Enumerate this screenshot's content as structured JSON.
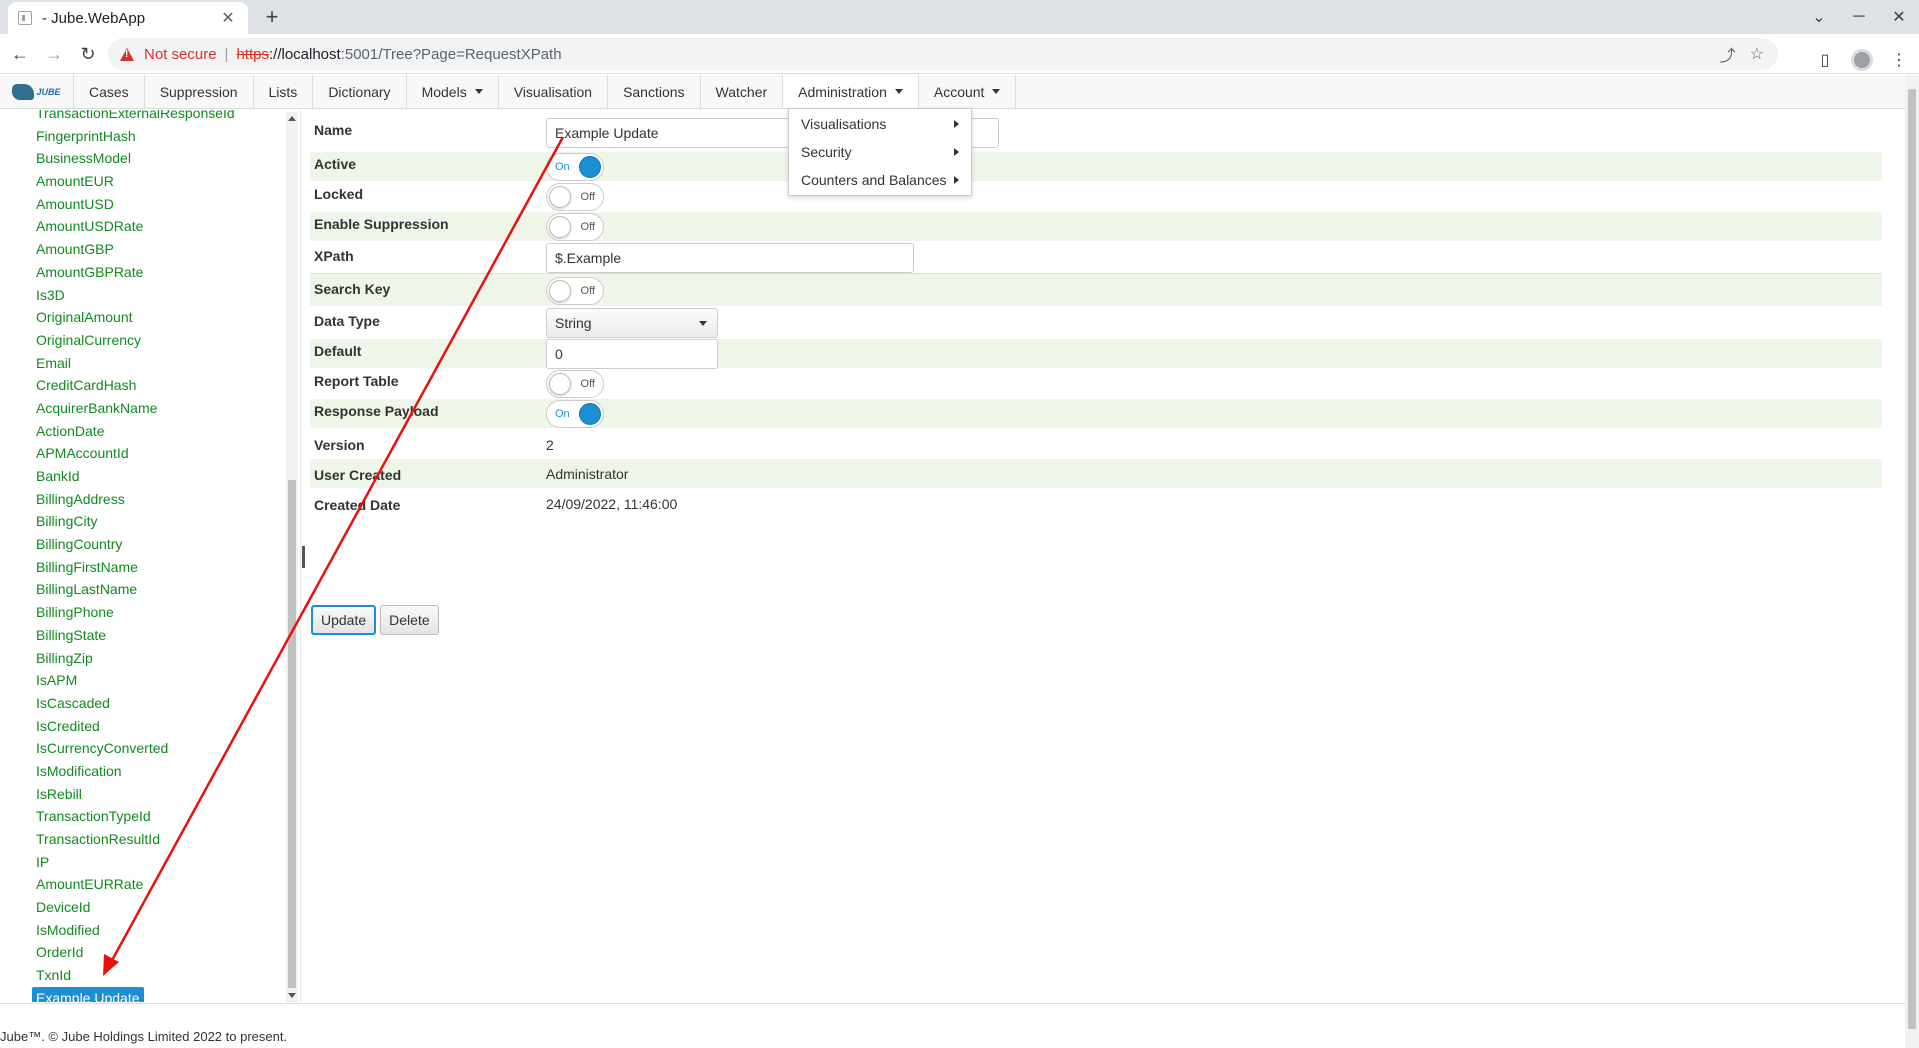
{
  "browser": {
    "tab_title": "- Jube.WebApp",
    "tab_close": "✕",
    "new_tab": "+",
    "window_controls": [
      "⌄",
      "─",
      "✕"
    ],
    "not_secure": "Not secure",
    "separator": "|",
    "url_scheme": "https",
    "url_host": "://localhost",
    "url_rest": ":5001/Tree?Page=RequestXPath"
  },
  "logo_text": "JUBE",
  "nav": {
    "cases": "Cases",
    "suppression": "Suppression",
    "lists": "Lists",
    "dictionary": "Dictionary",
    "models": "Models",
    "visualisation": "Visualisation",
    "sanctions": "Sanctions",
    "watcher": "Watcher",
    "administration": "Administration",
    "account": "Account"
  },
  "admin_menu": {
    "visualisations": "Visualisations",
    "security": "Security",
    "counters_and_balances": "Counters and Balances"
  },
  "tree": {
    "partial_top": "TransactionExternalResponseId",
    "items": [
      "FingerprintHash",
      "BusinessModel",
      "AmountEUR",
      "AmountUSD",
      "AmountUSDRate",
      "AmountGBP",
      "AmountGBPRate",
      "Is3D",
      "OriginalAmount",
      "OriginalCurrency",
      "Email",
      "CreditCardHash",
      "AcquirerBankName",
      "ActionDate",
      "APMAccountId",
      "BankId",
      "BillingAddress",
      "BillingCity",
      "BillingCountry",
      "BillingFirstName",
      "BillingLastName",
      "BillingPhone",
      "BillingState",
      "BillingZip",
      "IsAPM",
      "IsCascaded",
      "IsCredited",
      "IsCurrencyConverted",
      "IsModification",
      "IsRebill",
      "TransactionTypeId",
      "TransactionResultId",
      "IP",
      "AmountEURRate",
      "DeviceId",
      "IsModified",
      "OrderId",
      "TxnId"
    ],
    "selected": "Example Update"
  },
  "form": {
    "name_label": "Name",
    "name_value": "Example Update",
    "active_label": "Active",
    "active_state": "On",
    "locked_label": "Locked",
    "locked_state": "Off",
    "enable_suppression_label": "Enable Suppression",
    "enable_suppression_state": "Off",
    "xpath_label": "XPath",
    "xpath_value": "$.Example",
    "search_key_label": "Search Key",
    "search_key_state": "Off",
    "data_type_label": "Data Type",
    "data_type_value": "String",
    "default_label": "Default",
    "default_value": "0",
    "report_table_label": "Report Table",
    "report_table_state": "Off",
    "response_payload_label": "Response Payload",
    "response_payload_state": "On",
    "version_label": "Version",
    "version_value": "2",
    "user_created_label": "User Created",
    "user_created_value": "Administrator",
    "created_date_label": "Created Date",
    "created_date_value": "24/09/2022, 11:46:00",
    "update_button": "Update",
    "delete_button": "Delete"
  },
  "footer": "Jube™. © Jube Holdings Limited 2022 to present.",
  "annotation_color": "#e8120c",
  "accent_color": "#1c8ed2",
  "tree_text_color": "#128a1e"
}
